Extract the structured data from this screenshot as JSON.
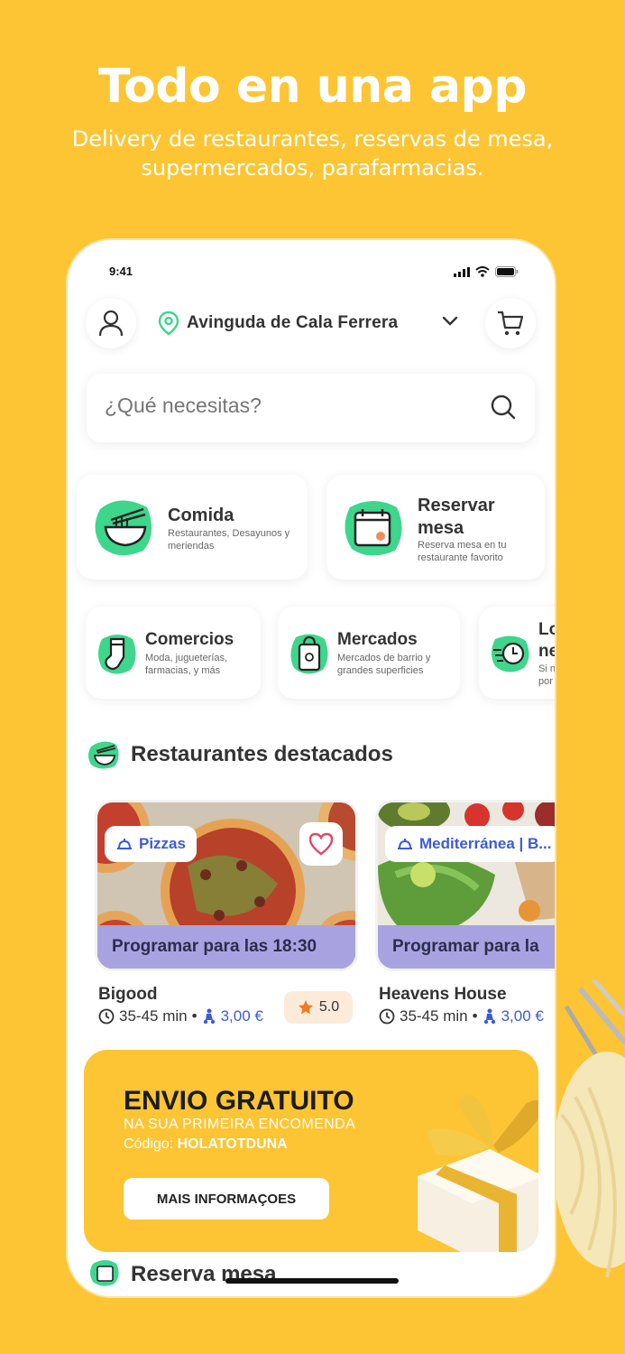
{
  "hero": {
    "title": "Todo en una app",
    "subtitle": "Delivery de restaurantes, reservas de mesa, supermercados, parafarmacias."
  },
  "status_bar": {
    "time": "9:41"
  },
  "header": {
    "address": "Avinguda de Cala Ferrera"
  },
  "search": {
    "placeholder": "¿Qué necesitas?"
  },
  "categories": [
    {
      "title": "Comida",
      "desc": "Restaurantes, Desayunos y meriendas"
    },
    {
      "title": "Reservar mesa",
      "desc": "Reserva mesa en tu restaurante favorito"
    },
    {
      "title": "Comercios",
      "desc": "Moda, jugueterías, farmacias, y más"
    },
    {
      "title": "Mercados",
      "desc": "Mercados de barrio y grandes superficies"
    },
    {
      "title": "Lo ne",
      "desc": "Si n por"
    }
  ],
  "featured": {
    "title": "Restaurantes destacados",
    "restaurants": [
      {
        "tag": "Pizzas",
        "schedule": "Programar para las 18:30",
        "name": "Bigood",
        "time": "35-45 min",
        "fee": "3,00 €",
        "rating": "5.0"
      },
      {
        "tag": "Mediterránea | B...",
        "schedule": "Programar para la",
        "name": "Heavens House",
        "time": "35-45 min",
        "fee": "3,00 €"
      }
    ]
  },
  "promo": {
    "title": "ENVIO GRATUITO",
    "subtitle": "NA SUA PRIMEIRA ENCOMENDA",
    "code_label": "Código:",
    "code": "HOLATOTDUNA",
    "button": "MAIS INFORMAÇOES"
  },
  "reserve_section": {
    "title": "Reserva mesa"
  },
  "colors": {
    "background": "#FDC533",
    "accent_green": "#3dd68c",
    "link_blue": "#3d5bd9",
    "schedule_bar": "#a8a3e0"
  }
}
